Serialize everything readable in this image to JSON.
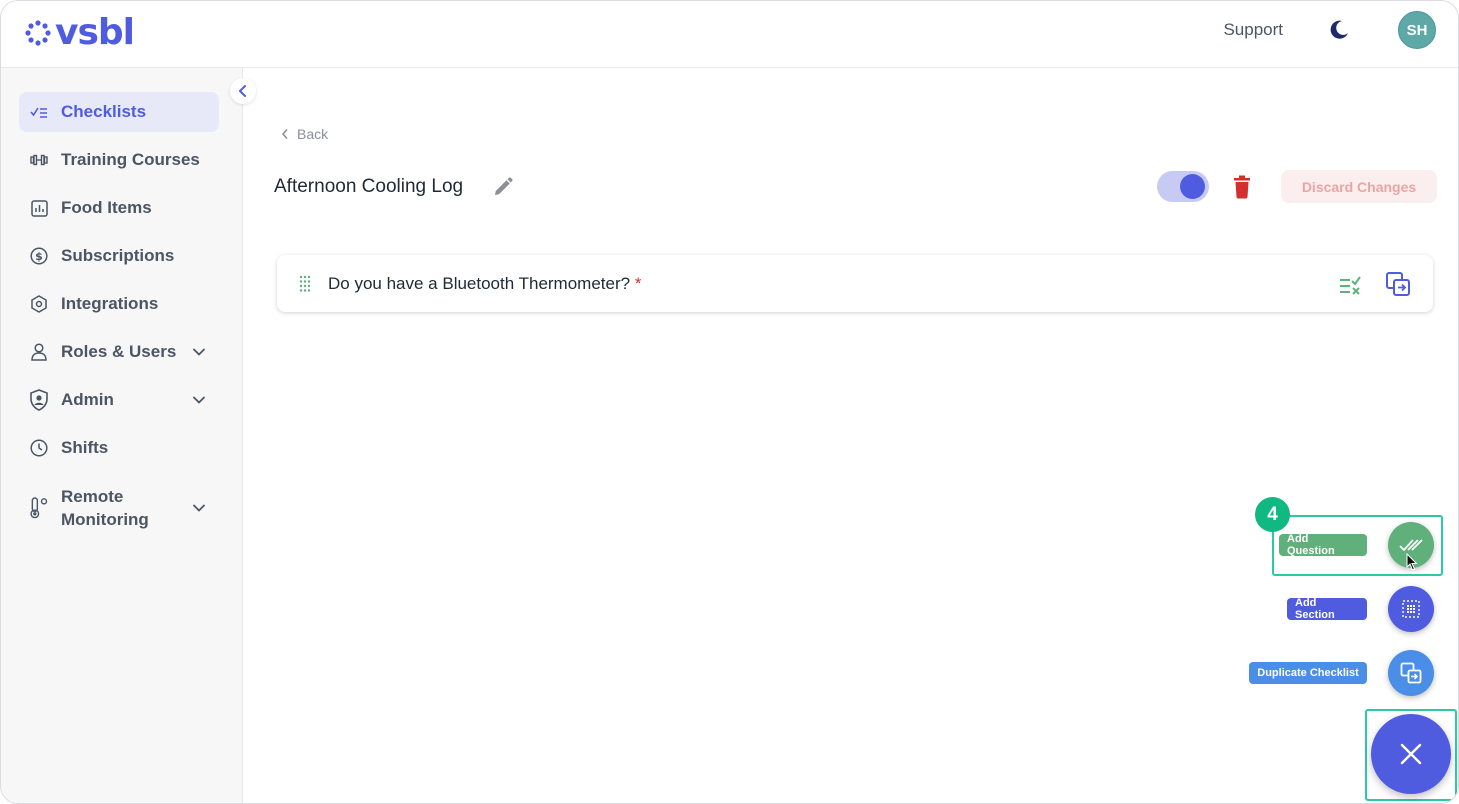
{
  "header": {
    "logo_text": "vsbl",
    "support_label": "Support",
    "theme_icon": "moon-icon",
    "avatar_initials": "SH"
  },
  "sidebar": {
    "collapse_icon": "chevron-left-icon",
    "items": [
      {
        "label": "Checklists",
        "icon": "checklist-icon",
        "active": true
      },
      {
        "label": "Training Courses",
        "icon": "dumbbell-icon"
      },
      {
        "label": "Food Items",
        "icon": "chart-icon"
      },
      {
        "label": "Subscriptions",
        "icon": "dollar-icon"
      },
      {
        "label": "Integrations",
        "icon": "integrations-icon"
      },
      {
        "label": "Roles & Users",
        "icon": "user-icon",
        "expandable": true
      },
      {
        "label": "Admin",
        "icon": "shield-user-icon",
        "expandable": true
      },
      {
        "label": "Shifts",
        "icon": "clock-icon"
      },
      {
        "label": "Remote Monitoring",
        "icon": "thermometer-icon",
        "expandable": true
      }
    ]
  },
  "main": {
    "back_label": "Back",
    "checklist_title": "Afternoon Cooling Log",
    "active_toggle": true,
    "discard_label": "Discard Changes",
    "questions": [
      {
        "text": "Do you have a Bluetooth Thermometer?",
        "required_mark": "*"
      }
    ]
  },
  "fab_menu": {
    "step_number": "4",
    "actions": [
      {
        "label": "Add Question",
        "color": "#5fb07a"
      },
      {
        "label": "Add Section",
        "color": "#4f5ce0"
      },
      {
        "label": "Duplicate Checklist",
        "color": "#4a8ee8"
      }
    ],
    "highlight_color": "#2bc9a4"
  },
  "colors": {
    "accent": "#4f5ce0",
    "danger": "#d32f2f",
    "success": "#10b981"
  }
}
